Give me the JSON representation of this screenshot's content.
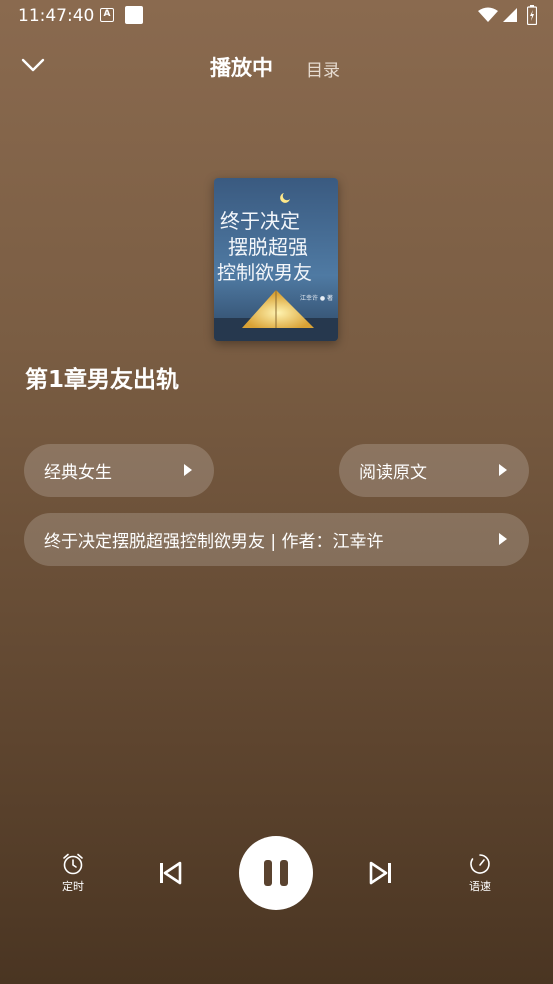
{
  "status": {
    "time": "11:47:40"
  },
  "header": {
    "active_tab": "播放中",
    "toc_tab": "目录"
  },
  "cover": {
    "title_line1": "终于决定",
    "title_line2": "摆脱超强",
    "title_line3": "控制欲男友",
    "author_tag": "江幸许 ● 著"
  },
  "chapter": {
    "title": "第1章男友出轨"
  },
  "pills": {
    "genre": "经典女生",
    "read_original": "阅读原文",
    "book_info": "终于决定摆脱超强控制欲男友 | 作者：江幸许"
  },
  "controls": {
    "timer_label": "定时",
    "speed_label": "语速"
  },
  "colors": {
    "bg_top": "#8a6a4f",
    "bg_bottom": "#4a3522",
    "pill_bg": "rgba(255,255,255,0.18)",
    "pause_icon": "#5a432f"
  }
}
